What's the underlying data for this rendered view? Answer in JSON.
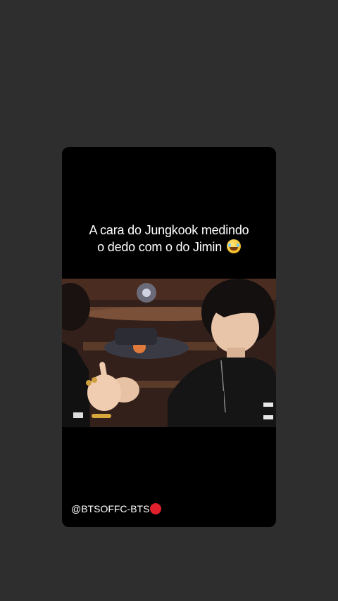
{
  "story": {
    "caption_line1": "A cara do Jungkook medindo",
    "caption_line2": "o dedo com o do Jimin",
    "caption_emoji": "tears-of-joy-emoji",
    "watermark": "@BTSOFFC-BTS",
    "watermark_icon": "red-circle-icon"
  },
  "colors": {
    "background": "#2f2e2e",
    "card": "#000000",
    "text": "#ffffff",
    "record_dot": "#e0202a"
  }
}
